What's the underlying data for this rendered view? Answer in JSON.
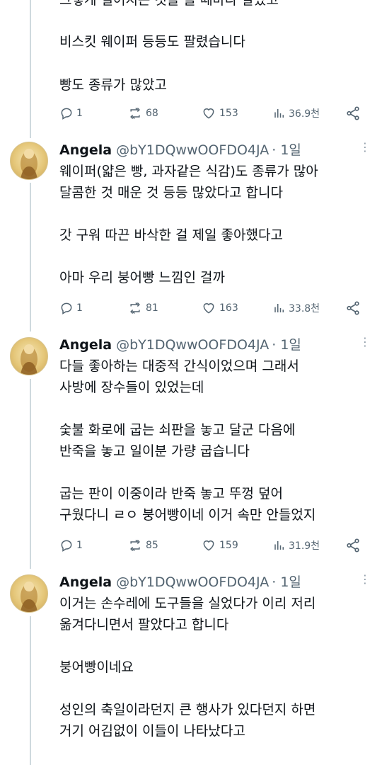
{
  "post0": {
    "clipped_line": "그렇게 벌어지는 것을 볼 때마다 알았고",
    "lines": [
      "비스킷 웨이퍼 등등도 팔렸습니다",
      "빵도 종류가 많았고"
    ],
    "stats": {
      "replies": "1",
      "reposts": "68",
      "likes": "153",
      "views": "36.9천"
    }
  },
  "post1": {
    "name": "Angela",
    "handle": "@bY1DQwwOOFDO4JA",
    "time": "· 1일",
    "lines": [
      "웨이퍼(얇은 빵, 과자같은 식감)도 종류가 많아",
      "달콤한 것 매운 것 등등 많았다고 합니다",
      "",
      "갓 구워 따끈 바삭한 걸 제일 좋아했다고",
      "",
      "아마 우리 붕어빵 느낌인 걸까"
    ],
    "stats": {
      "replies": "1",
      "reposts": "81",
      "likes": "163",
      "views": "33.8천"
    }
  },
  "post2": {
    "name": "Angela",
    "handle": "@bY1DQwwOOFDO4JA",
    "time": "· 1일",
    "lines": [
      "다들 좋아하는 대중적 간식이었으며 그래서",
      "사방에 장수들이 있었는데",
      "",
      "숯불 화로에 굽는 쇠판을 놓고 달군 다음에",
      "반죽을 놓고 일이분 가량 굽습니다",
      "",
      "굽는 판이 이중이라 반죽 놓고 뚜껑 덮어",
      "구웠다니 ㄹㅇ 붕어빵이네 이거 속만 안들었지"
    ],
    "stats": {
      "replies": "1",
      "reposts": "85",
      "likes": "159",
      "views": "31.9천"
    }
  },
  "post3": {
    "name": "Angela",
    "handle": "@bY1DQwwOOFDO4JA",
    "time": "· 1일",
    "lines": [
      "이거는 손수레에 도구들을 실었다가 이리 저리",
      "옮겨다니면서 팔았다고 합니다",
      "",
      "붕어빵이네요",
      "",
      "성인의 축일이라던지 큰 행사가 있다던지 하면",
      "거기 어김없이 이들이 나타났다고"
    ]
  }
}
